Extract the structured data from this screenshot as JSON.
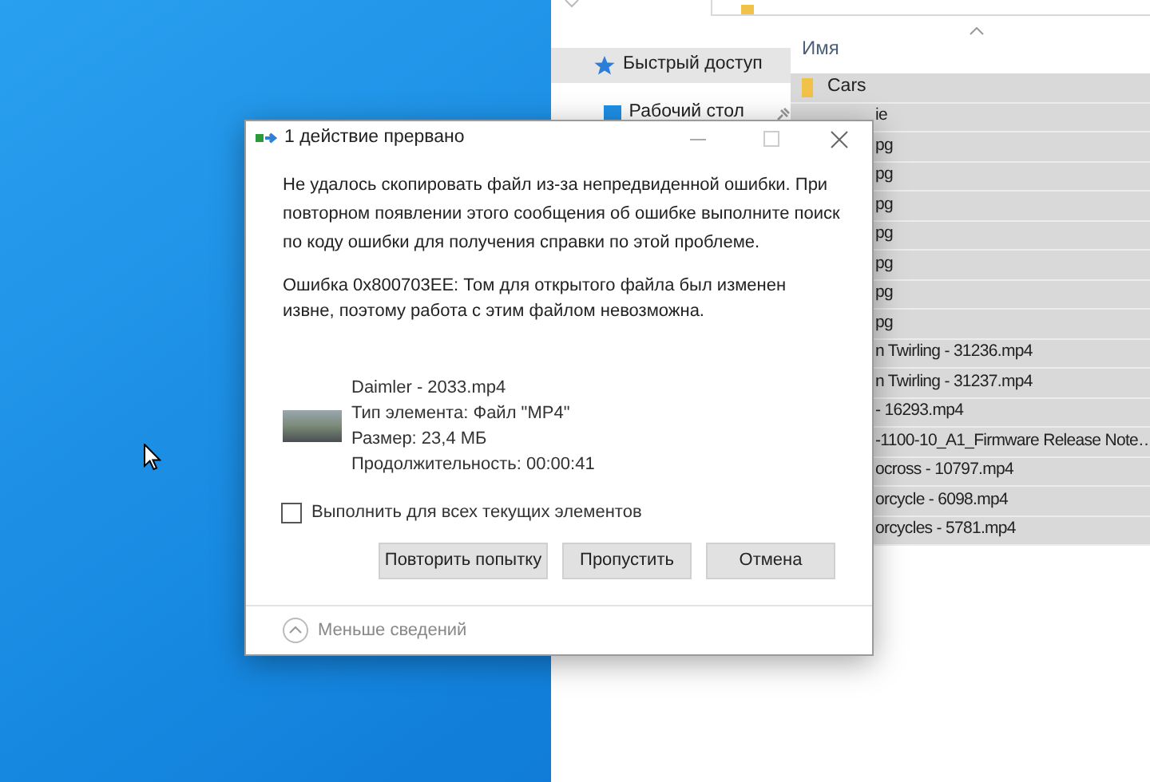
{
  "explorer": {
    "column_header": "Имя",
    "nav_items": [
      {
        "label": "Быстрый доступ",
        "selected": true
      },
      {
        "label": "Рабочий стол",
        "selected": false,
        "pinned": true
      }
    ],
    "files": [
      {
        "name": "Cars",
        "kind": "folder"
      },
      {
        "name": "ie",
        "kind": "fragment"
      },
      {
        "name": "pg",
        "kind": "fragment"
      },
      {
        "name": "pg",
        "kind": "fragment"
      },
      {
        "name": "pg",
        "kind": "fragment"
      },
      {
        "name": "pg",
        "kind": "fragment"
      },
      {
        "name": "pg",
        "kind": "fragment"
      },
      {
        "name": "pg",
        "kind": "fragment"
      },
      {
        "name": "pg",
        "kind": "fragment"
      },
      {
        "name": "n Twirling - 31236.mp4",
        "kind": "fragment"
      },
      {
        "name": "n Twirling - 31237.mp4",
        "kind": "fragment"
      },
      {
        "name": "- 16293.mp4",
        "kind": "fragment"
      },
      {
        "name": "-1100-10_A1_Firmware Release Note…",
        "kind": "fragment"
      },
      {
        "name": "ocross - 10797.mp4",
        "kind": "fragment"
      },
      {
        "name": "orcycle - 6098.mp4",
        "kind": "fragment"
      },
      {
        "name": "orcycles - 5781.mp4",
        "kind": "fragment"
      }
    ]
  },
  "dialog": {
    "title": "1 действие прервано",
    "message": "Не удалось скопировать файл из-за непредвиденной ошибки. При повторном появлении этого сообщения об ошибке выполните поиск по коду ошибки для получения справки по этой проблеме.",
    "error": "Ошибка 0x800703EE: Том для открытого файла был изменен извне, поэтому работа с этим файлом невозможна.",
    "file_details": [
      "Daimler - 2033.mp4",
      "Тип элемента: Файл \"MP4\"",
      "Размер: 23,4 МБ",
      "Продолжительность: 00:00:41"
    ],
    "apply_all": {
      "label": "Выполнить для всех текущих элементов",
      "checked": false
    },
    "buttons": [
      "Повторить попытку",
      "Пропустить",
      "Отмена"
    ],
    "details_toggle": "Меньше сведений"
  }
}
